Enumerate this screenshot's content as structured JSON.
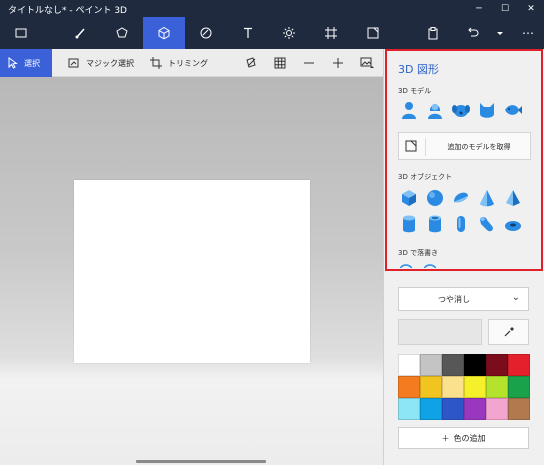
{
  "window": {
    "title": "タイトルなし* - ペイント 3D",
    "minimize_glyph": "─",
    "maximize_glyph": "☐",
    "close_glyph": "✕"
  },
  "main_toolbar": {
    "active": "3d-shapes",
    "items": [
      "menu-icon",
      "brushes-icon",
      "2d-shapes-icon",
      "3d-shapes-icon",
      "stickers-icon",
      "text-icon",
      "effects-icon",
      "canvas-icon",
      "3d-library-icon",
      "paste-icon",
      "undo-icon",
      "history-icon",
      "more-icon"
    ],
    "more_label": "⋯"
  },
  "sub_toolbar": {
    "select_label": "選択",
    "magic_select_label": "マジック選択",
    "crop_label": "トリミング"
  },
  "panel": {
    "title": "3D 図形",
    "models_heading": "3D モデル",
    "get_more_label": "追加のモデルを取得",
    "objects_heading": "3D オブジェクト",
    "doodles_heading": "3D で落書き",
    "finish_label": "つや消し",
    "add_color_label": "色の追加",
    "add_color_glyph": "＋",
    "chevron_glyph": "⌄"
  },
  "palette": {
    "colors": [
      "#ffffff",
      "#c4c4c4",
      "#575757",
      "#000000",
      "#7a0c1b",
      "#e3202b",
      "#f47b20",
      "#f2c41f",
      "#fbe08e",
      "#f6f02a",
      "#b4e32d",
      "#1aa24b",
      "#8de6f6",
      "#10a2e6",
      "#2d57c8",
      "#9a37c0",
      "#f4a5cf",
      "#b07a4e"
    ]
  },
  "colors": {
    "title_bg": "#1f2a3f",
    "accent": "#3a61d8",
    "highlight": "#e0202b",
    "shape_blue": "#2b8be3"
  }
}
